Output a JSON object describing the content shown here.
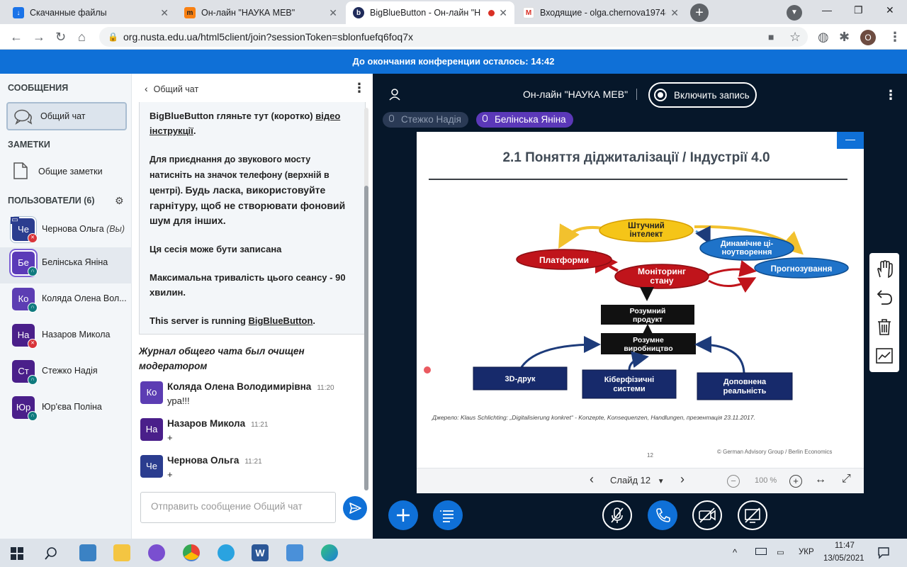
{
  "browser": {
    "tabs": [
      {
        "title": "Скачанные файлы",
        "icon": "download-icon"
      },
      {
        "title": "Он-лайн \"НАУКА МЕВ\"",
        "icon": "moodle-icon"
      },
      {
        "title": "BigBlueButton - Он-лайн \"Н",
        "icon": "bbb-icon"
      },
      {
        "title": "Входящие - olga.chernova1974@",
        "icon": "gmail-icon"
      }
    ],
    "url": "org.nusta.edu.ua/html5client/join?sessionToken=sblonfuefq6foq7x",
    "profile_initial": "O"
  },
  "banner": "До окончания конференции осталось: 14:42",
  "userlist": {
    "messages_header": "СООБЩЕНИЯ",
    "public_chat": "Общий чат",
    "notes_header": "ЗАМЕТКИ",
    "shared_notes": "Общие заметки",
    "users_header": "ПОЛЬЗОВАТЕЛИ (6)",
    "users": [
      {
        "initials": "Че",
        "name": "Чернова Ольга",
        "suffix": "(Вы)",
        "color": "#2b3d8f",
        "status": "muted"
      },
      {
        "initials": "Бе",
        "name": "Белінська Яніна",
        "suffix": "",
        "color": "#5b3ab8",
        "status": "listen"
      },
      {
        "initials": "Ко",
        "name": "Коляда Олена Вол...",
        "suffix": "",
        "color": "#5c3db3",
        "status": "listen"
      },
      {
        "initials": "На",
        "name": "Назаров Микола",
        "suffix": "",
        "color": "#4a1f8a",
        "status": "muted"
      },
      {
        "initials": "Ст",
        "name": "Стежко Надія",
        "suffix": "",
        "color": "#4a1f8a",
        "status": "listen"
      },
      {
        "initials": "Юр",
        "name": "Юр'єва Поліна",
        "suffix": "",
        "color": "#4a1f8a",
        "status": "listen"
      }
    ]
  },
  "chat": {
    "header": "Общий чат",
    "welcome": {
      "p1_text": "BigBlueButton гляньте тут (коротко) ",
      "p1_link": "відео інструкції",
      "p1_end": ".",
      "p2_a": "Для приєднання до звукового мосту натисніть на значок телефону (верхній в центрі). ",
      "p2_b": "Будь ласка, використовуйте гарнітуру, щоб не створювати фоновий шум для інших.",
      "p3": "Ця сесія може бути записана",
      "p4": "Максимальна тривалість цього сеансу - 90 хвилин.",
      "p5_text": "This server is running ",
      "p5_link": "BigBlueButton",
      "p5_end": "."
    },
    "cleared_notice": "Журнал общего чата был очищен модератором",
    "messages": [
      {
        "initials": "Ко",
        "name": "Коляда Олена Володимирівна",
        "time": "11:20",
        "text": "ура!!!",
        "color": "#5c3db3"
      },
      {
        "initials": "На",
        "name": "Назаров Микола",
        "time": "11:21",
        "text": "+",
        "color": "#4a1f8a"
      },
      {
        "initials": "Че",
        "name": "Чернова Ольга",
        "time": "11:21",
        "text": "+",
        "color": "#2b3d8f"
      }
    ],
    "input_placeholder": "Отправить сообщение Общий чат"
  },
  "meeting": {
    "title": "Он-лайн \"НАУКА МЕВ\"",
    "record_label": "Включить запись",
    "talkers": [
      "Стежко Надія",
      "Белінська Яніна"
    ]
  },
  "slide": {
    "title": "2.1 Поняття діджиталізації / Індустрії 4.0",
    "nodes": {
      "ai": "Штучний інтелект",
      "platforms": "Платформи",
      "monitoring": "Моніторинг стану",
      "dynamic": "Динамічне ці-ноутворення",
      "forecast": "Прогнозування",
      "smart_product": "Розумний продукт",
      "smart_production": "Розумне виробництво",
      "print3d": "3D-друк",
      "cps": "Кіберфізичні системи",
      "ar": "Доповнена реальність"
    },
    "source": "Джерело: Klaus Schlichting: „Digitalisierung konkret“ - Konzepte, Konsequenzen, Handlungen, презентація 23.11.2017.",
    "page_number": "12",
    "copyright": "© German Advisory Group / Berlin Economics"
  },
  "slidebar": {
    "slide_label": "Слайд 12",
    "zoom": "100 %"
  },
  "taskbar": {
    "lang": "УКР",
    "time": "11:47",
    "date": "13/05/2021"
  }
}
